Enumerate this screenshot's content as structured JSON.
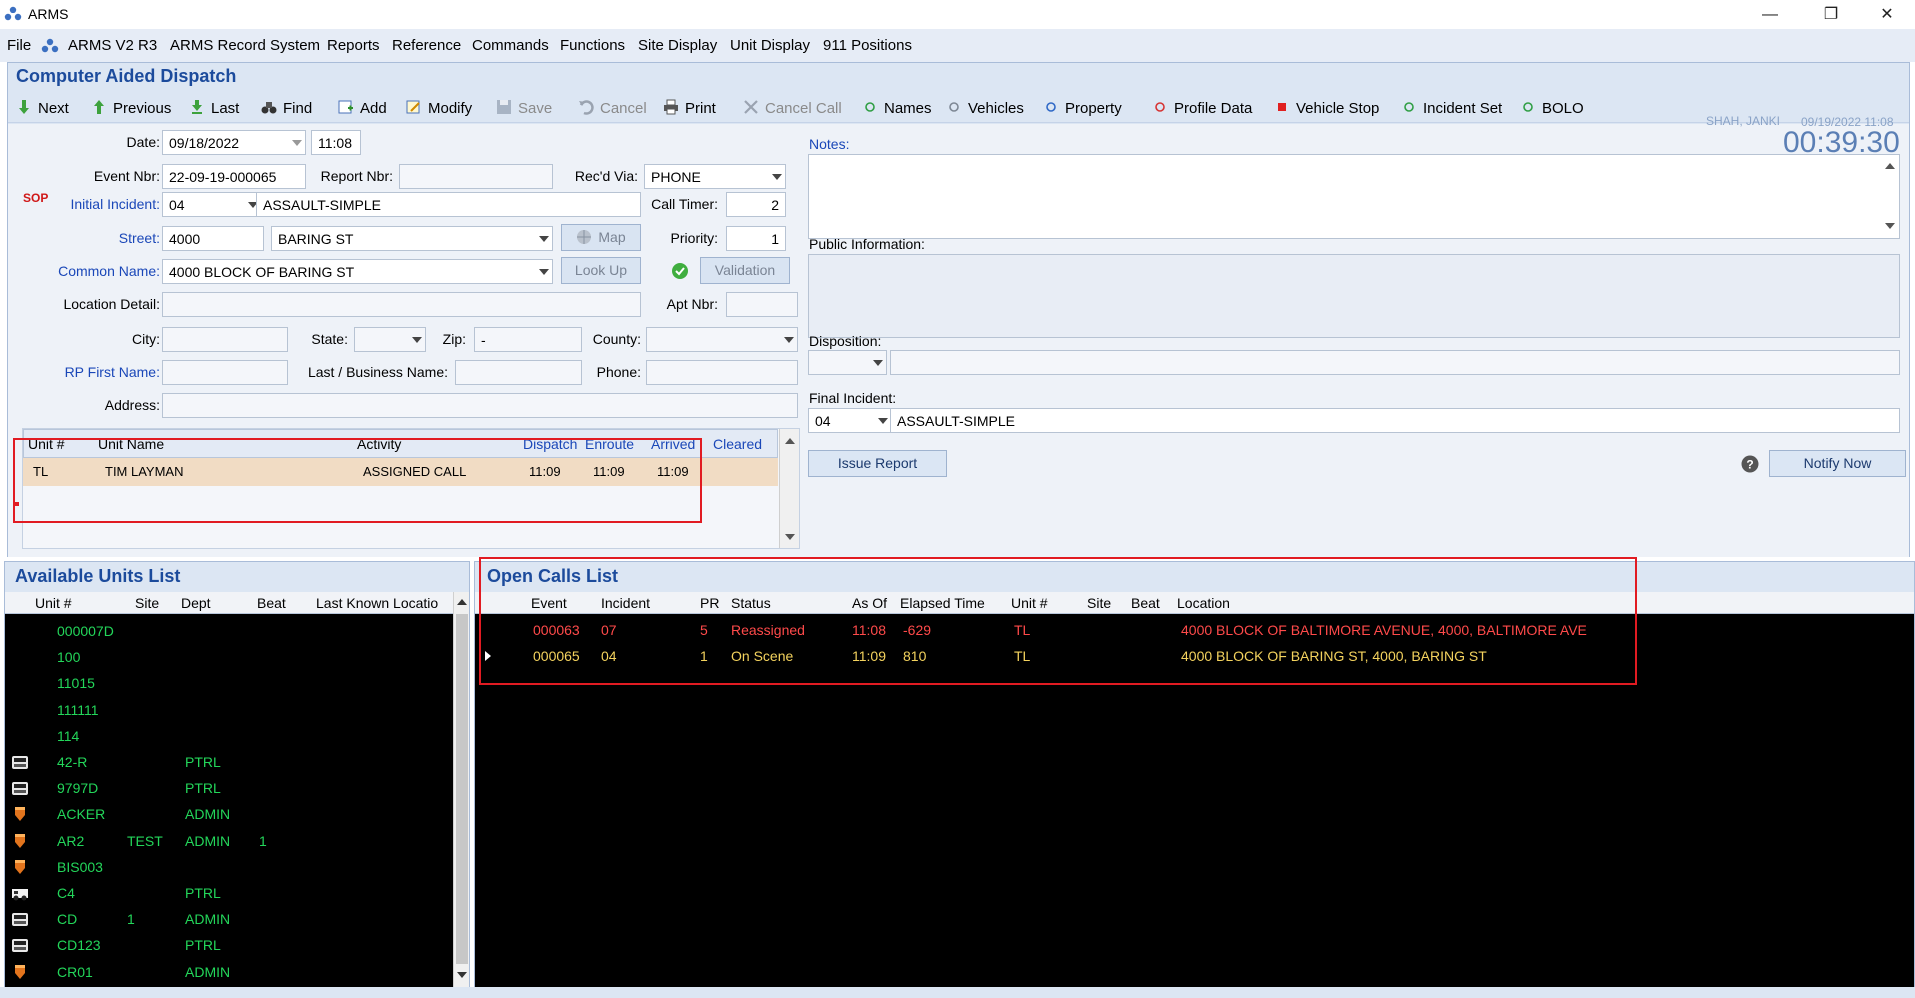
{
  "window": {
    "title": "ARMS",
    "controls": [
      "—",
      "❐",
      "✕"
    ]
  },
  "menu": [
    "File",
    "ARMS V2 R3",
    "ARMS Record System",
    "Reports",
    "Reference",
    "Commands",
    "Functions",
    "Site Display",
    "Unit Display",
    "911 Positions"
  ],
  "cad": {
    "title": "Computer Aided Dispatch",
    "toolbar": {
      "next": "Next",
      "previous": "Previous",
      "last": "Last",
      "find": "Find",
      "add": "Add",
      "modify": "Modify",
      "save": "Save",
      "cancel": "Cancel",
      "print": "Print",
      "cancel_call": "Cancel Call",
      "names": "Names",
      "vehicles": "Vehicles",
      "property": "Property",
      "profile_data": "Profile Data",
      "vehicle_stop": "Vehicle Stop",
      "incident_set": "Incident Set",
      "bolo": "BOLO"
    },
    "user": "SHAH, JANKI",
    "user_datetime": "09/19/2022 11:08",
    "timer": "00:39:30",
    "form": {
      "date_label": "Date:",
      "date": "09/18/2022",
      "time": "11:08",
      "event_nbr_label": "Event Nbr:",
      "event_nbr": "22-09-19-000065",
      "report_nbr_label": "Report Nbr:",
      "report_nbr": "",
      "recd_via_label": "Rec'd Via:",
      "recd_via": "PHONE",
      "sop": "SOP",
      "initial_incident_label": "Initial Incident:",
      "initial_incident_code": "04",
      "initial_incident_desc": "ASSAULT-SIMPLE",
      "call_timer_label": "Call Timer:",
      "call_timer": "2",
      "street_label": "Street:",
      "street_number": "4000",
      "street_name": "BARING ST",
      "map_button": "Map",
      "priority_label": "Priority:",
      "priority": "1",
      "common_name_label": "Common Name:",
      "common_name": "4000 BLOCK OF BARING ST",
      "look_up_button": "Look Up",
      "validation_button": "Validation",
      "location_detail_label": "Location Detail:",
      "apt_nbr_label": "Apt Nbr:",
      "city_label": "City:",
      "state_label": "State:",
      "zip_label": "Zip:",
      "zip": "-",
      "county_label": "County:",
      "rp_first_name_label": "RP First Name:",
      "last_business_label": "Last / Business Name:",
      "phone_label": "Phone:",
      "address_label": "Address:",
      "notes_label": "Notes:",
      "public_info_label": "Public  Information:",
      "disposition_label": "Disposition:",
      "final_incident_label": "Final Incident:",
      "final_incident_code": "04",
      "final_incident_desc": "ASSAULT-SIMPLE",
      "issue_report_button": "Issue Report",
      "notify_now_button": "Notify Now"
    },
    "units_grid": {
      "headers": [
        "Unit #",
        "Unit Name",
        "Activity",
        "Dispatch",
        "Enroute",
        "Arrived",
        "Cleared"
      ],
      "rows": [
        {
          "unit": "TL",
          "name": "TIM LAYMAN",
          "activity": "ASSIGNED CALL",
          "dispatch": "11:09",
          "enroute": "11:09",
          "arrived": "11:09",
          "cleared": ""
        }
      ]
    }
  },
  "available_units": {
    "title": "Available Units List",
    "headers": [
      "Unit #",
      "Site",
      "Dept",
      "Beat",
      "Last Known Locatio"
    ],
    "rows": [
      {
        "unit": "000007D",
        "site": "",
        "dept": "",
        "beat": "",
        "icon": "none"
      },
      {
        "unit": "100",
        "site": "",
        "dept": "",
        "beat": "",
        "icon": "none"
      },
      {
        "unit": "11015",
        "site": "",
        "dept": "",
        "beat": "",
        "icon": "none"
      },
      {
        "unit": "111111",
        "site": "",
        "dept": "",
        "beat": "",
        "icon": "none"
      },
      {
        "unit": "114",
        "site": "",
        "dept": "",
        "beat": "",
        "icon": "none"
      },
      {
        "unit": "42-R",
        "site": "",
        "dept": "PTRL",
        "beat": "",
        "icon": "car"
      },
      {
        "unit": "9797D",
        "site": "",
        "dept": "PTRL",
        "beat": "",
        "icon": "car"
      },
      {
        "unit": "ACKER",
        "site": "",
        "dept": "ADMIN",
        "beat": "",
        "icon": "badge"
      },
      {
        "unit": "AR2",
        "site": "TEST",
        "dept": "ADMIN",
        "beat": "1",
        "icon": "badge"
      },
      {
        "unit": "BIS003",
        "site": "",
        "dept": "",
        "beat": "",
        "icon": "badge"
      },
      {
        "unit": "C4",
        "site": "",
        "dept": "PTRL",
        "beat": "",
        "icon": "truck"
      },
      {
        "unit": "CD",
        "site": "1",
        "dept": "ADMIN",
        "beat": "",
        "icon": "car"
      },
      {
        "unit": "CD123",
        "site": "",
        "dept": "PTRL",
        "beat": "",
        "icon": "car"
      },
      {
        "unit": "CR01",
        "site": "",
        "dept": "ADMIN",
        "beat": "",
        "icon": "badge"
      }
    ]
  },
  "open_calls": {
    "title": "Open Calls List",
    "headers": [
      "Event",
      "Incident",
      "PR",
      "Status",
      "As Of",
      "Elapsed Time",
      "Unit #",
      "Site",
      "Beat",
      "Location"
    ],
    "rows": [
      {
        "event": "000063",
        "incident": "07",
        "pr": "5",
        "status": "Reassigned",
        "as_of": "11:08",
        "elapsed": "-629",
        "unit": "TL",
        "site": "",
        "beat": "",
        "location": "4000 BLOCK OF BALTIMORE AVENUE, 4000, BALTIMORE AVE",
        "color": "#ff4a4a"
      },
      {
        "event": "000065",
        "incident": "04",
        "pr": "1",
        "status": "On Scene",
        "as_of": "11:09",
        "elapsed": "810",
        "unit": "TL",
        "site": "",
        "beat": "",
        "location": "4000 BLOCK OF BARING ST, 4000, BARING ST",
        "color": "#f4d35e"
      }
    ]
  },
  "colors": {
    "header_blue": "#1c4b9c",
    "link_blue": "#1a47b8",
    "unit_green": "#23d65a",
    "highlight_red": "#e11b22"
  }
}
